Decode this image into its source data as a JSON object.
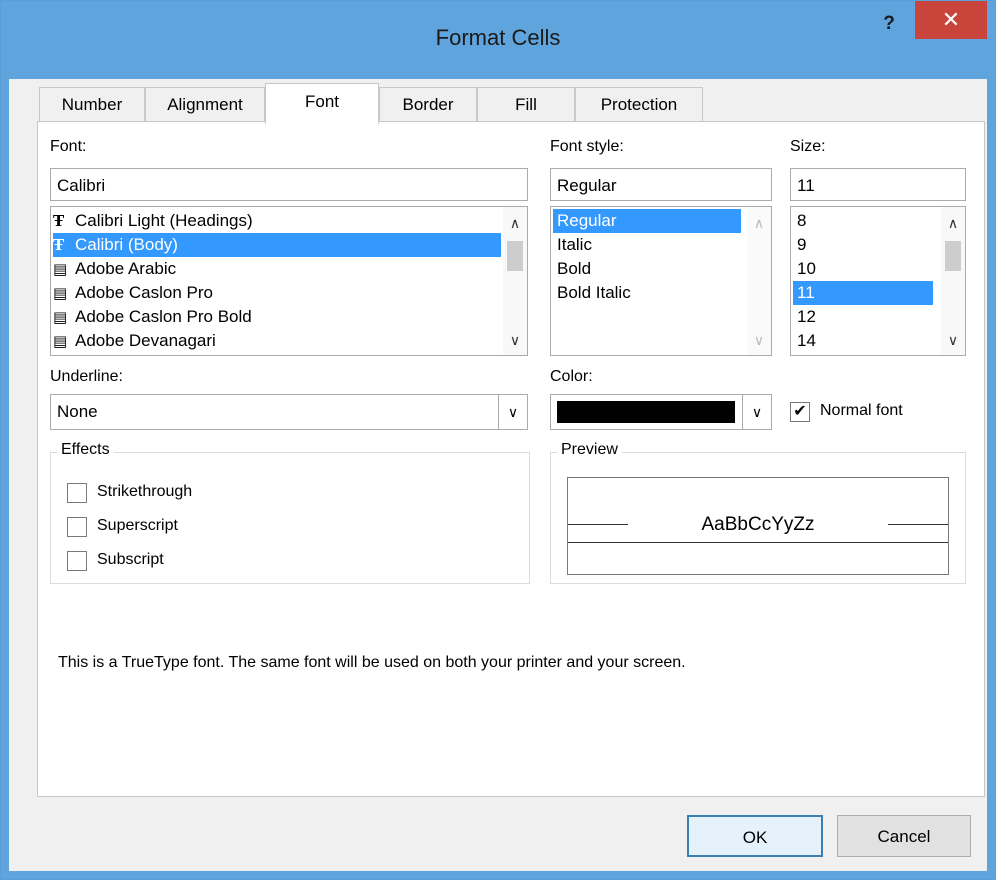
{
  "window": {
    "title": "Format Cells",
    "help_glyph": "?",
    "close_glyph": "✕"
  },
  "tabs": [
    {
      "label": "Number"
    },
    {
      "label": "Alignment"
    },
    {
      "label": "Font"
    },
    {
      "label": "Border"
    },
    {
      "label": "Fill"
    },
    {
      "label": "Protection"
    }
  ],
  "active_tab": "Font",
  "font": {
    "label": "Font:",
    "value": "Calibri",
    "items": [
      {
        "label": "Calibri Light (Headings)",
        "icon": "truetype-icon"
      },
      {
        "label": "Calibri (Body)",
        "icon": "truetype-icon",
        "selected": true
      },
      {
        "label": "Adobe Arabic",
        "icon": "opentype-icon"
      },
      {
        "label": "Adobe Caslon Pro",
        "icon": "opentype-icon"
      },
      {
        "label": "Adobe Caslon Pro Bold",
        "icon": "opentype-icon"
      },
      {
        "label": "Adobe Devanagari",
        "icon": "opentype-icon"
      }
    ]
  },
  "font_style": {
    "label": "Font style:",
    "value": "Regular",
    "items": [
      "Regular",
      "Italic",
      "Bold",
      "Bold Italic"
    ],
    "selected": "Regular"
  },
  "size": {
    "label": "Size:",
    "value": "11",
    "items": [
      "8",
      "9",
      "10",
      "11",
      "12",
      "14"
    ],
    "selected": "11"
  },
  "underline": {
    "label": "Underline:",
    "value": "None"
  },
  "color": {
    "label": "Color:",
    "swatch": "#000000"
  },
  "normal_font": {
    "label": "Normal font",
    "checked": true
  },
  "effects": {
    "title": "Effects",
    "items": [
      {
        "label": "Strikethrough",
        "checked": false
      },
      {
        "label": "Superscript",
        "checked": false
      },
      {
        "label": "Subscript",
        "checked": false
      }
    ]
  },
  "preview": {
    "title": "Preview",
    "sample": "AaBbCcYyZz"
  },
  "info_text": "This is a TrueType font.  The same font will be used on both your printer and your screen.",
  "buttons": {
    "ok": "OK",
    "cancel": "Cancel"
  },
  "colors": {
    "titlebar": "#5fa4dd",
    "close": "#c9453b",
    "selection": "#3399ff"
  }
}
